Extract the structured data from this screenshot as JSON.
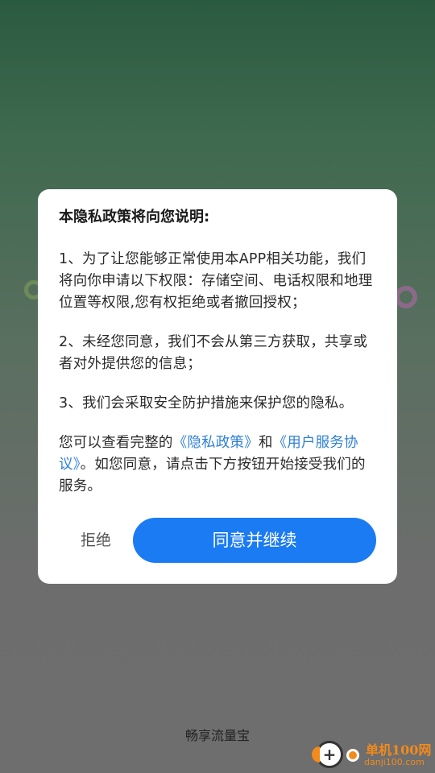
{
  "dialog": {
    "title": "本隐私政策将向您说明:",
    "para1": "1、为了让您能够正常使用本APP相关功能，我们将向你申请以下权限：存储空间、电话权限和地理位置等权限,您有权拒绝或者撤回授权；",
    "para2": "2、未经您同意，我们不会从第三方获取，共享或者对外提供您的信息；",
    "para3": "3、我们会采取安全防护措施来保护您的隐私。",
    "para4": {
      "prefix": "您可以查看完整的",
      "privacy_link": "《隐私政策》",
      "and": "和",
      "service_link": "《用户服务协议》",
      "suffix": "。如您同意，请点击下方按钮开始接受我们的服务。"
    },
    "refuse_label": "拒绝",
    "agree_label": "同意并继续"
  },
  "app_name": "畅享流量宝",
  "watermark": {
    "name": "单机100网",
    "url": "danji100.com",
    "plus_icon": "+"
  },
  "colors": {
    "accent": "#1b7bf3",
    "link": "#2f7fd9",
    "watermark": "#f28a1c"
  }
}
